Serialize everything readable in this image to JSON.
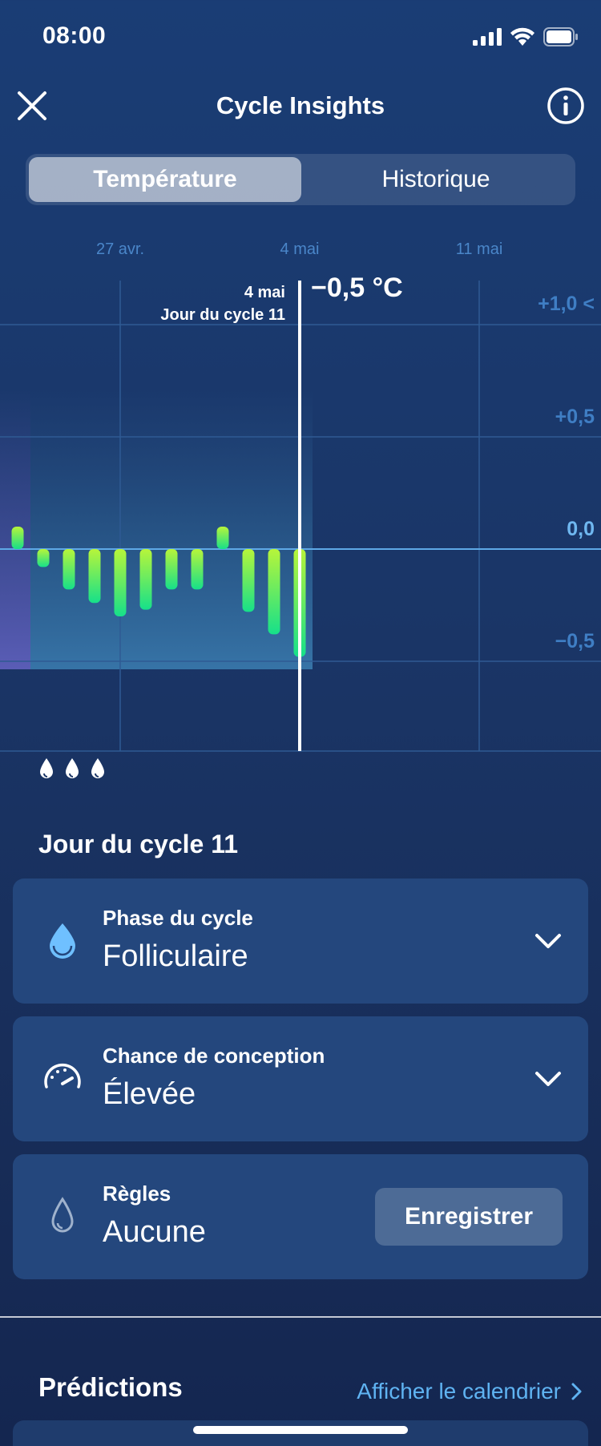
{
  "status_bar": {
    "time": "08:00"
  },
  "header": {
    "title": "Cycle Insights"
  },
  "tabs": {
    "temperature": "Température",
    "history": "Historique"
  },
  "chart": {
    "dates": [
      "27 avr.",
      "4 mai",
      "11 mai"
    ],
    "y_ticks": [
      "+1,0 <",
      "+0,5",
      "0,0",
      "−0,5"
    ],
    "tooltip": {
      "date": "4 mai",
      "cycle_day": "Jour du cycle 11",
      "value": "−0,5 °C"
    }
  },
  "chart_data": {
    "type": "bar",
    "ylabel": "",
    "ylim": [
      -0.9,
      1.2
    ],
    "x_ticks": [
      "27 avr.",
      "4 mai",
      "11 mai"
    ],
    "y_tick_labels": [
      "+1,0 <",
      "+0,5",
      "0,0",
      "−0,5"
    ],
    "values": [
      0.1,
      -0.08,
      -0.18,
      -0.24,
      -0.3,
      -0.27,
      -0.18,
      -0.18,
      0.1,
      -0.28,
      -0.38,
      -0.48
    ],
    "grid": true,
    "selected": {
      "date": "4 mai",
      "cycle_day": "Jour du cycle 11",
      "value": "−0,5 °C"
    }
  },
  "cycle_day": {
    "title": "Jour du cycle 11"
  },
  "cards": {
    "phase": {
      "label": "Phase du cycle",
      "value": "Folliculaire"
    },
    "conception": {
      "label": "Chance de conception",
      "value": "Élevée"
    },
    "period": {
      "label": "Règles",
      "value": "Aucune",
      "button": "Enregistrer"
    }
  },
  "predictions": {
    "title": "Prédictions",
    "link": "Afficher le calendrier"
  },
  "colors": {
    "accent": "#5fb3f2",
    "bar_top": "#b7f53a",
    "bar_bottom": "#16e08a",
    "card": "#24477d"
  },
  "icons": [
    "close-icon",
    "info-icon",
    "drop-icon",
    "gauge-icon",
    "chevron-down-icon",
    "chevron-right-icon"
  ]
}
